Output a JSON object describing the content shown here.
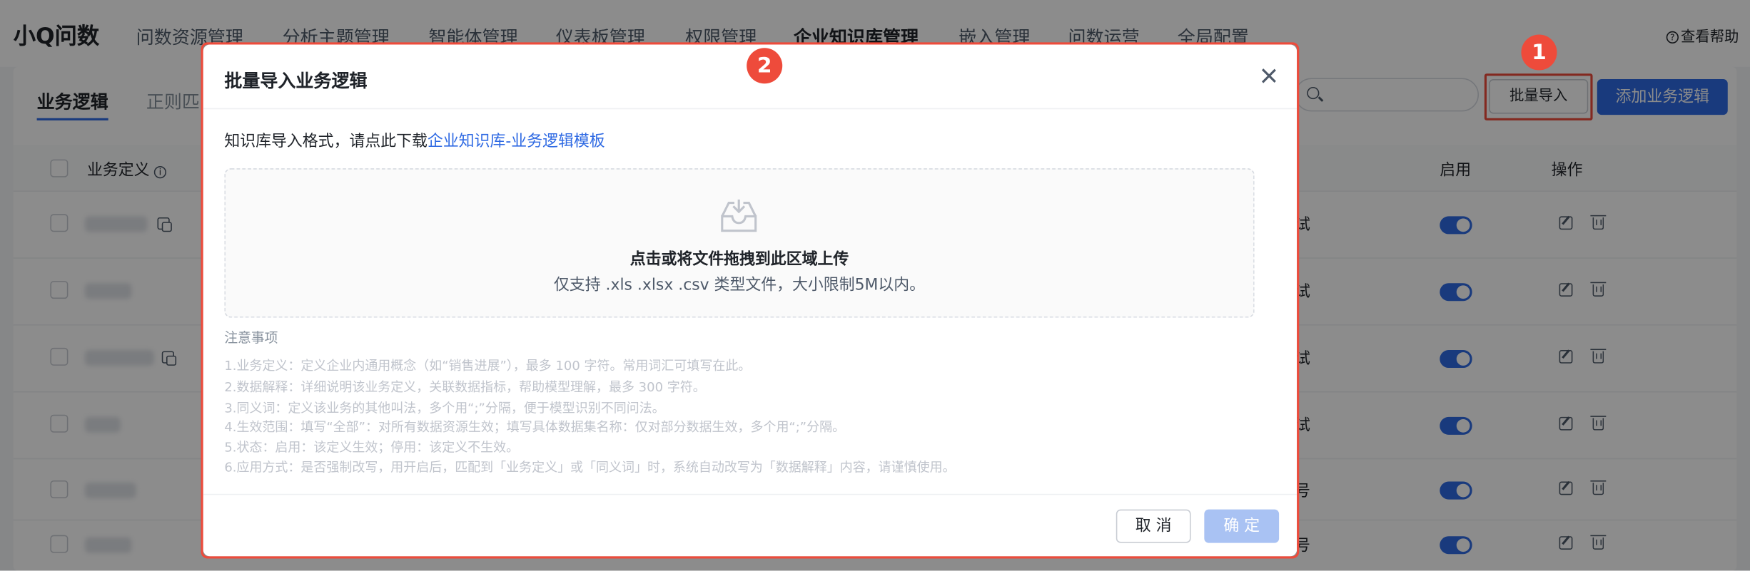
{
  "nav": {
    "brand": "小Q问数",
    "items": [
      "问数资源管理",
      "分析主题管理",
      "智能体管理",
      "仪表板管理",
      "权限管理",
      "企业知识库管理",
      "嵌入管理",
      "问数运营",
      "全局配置"
    ],
    "help": "查看帮助"
  },
  "tabs": {
    "business_logic": "业务逻辑",
    "regex_partial": "正则匹"
  },
  "toolbar": {
    "batch_import": "批量导入",
    "add_logic": "添加业务逻辑"
  },
  "table": {
    "headers": {
      "definition": "业务定义",
      "enabled": "启用",
      "actions": "操作"
    },
    "rows": [
      {
        "cell": "试",
        "enabled": true
      },
      {
        "cell": "试",
        "enabled": true
      },
      {
        "cell": "试",
        "enabled": true
      },
      {
        "cell": "试",
        "enabled": true
      },
      {
        "cell": "号",
        "enabled": true
      },
      {
        "cell": "号",
        "enabled": true
      }
    ]
  },
  "annotations": {
    "step1": "1",
    "step2": "2"
  },
  "modal": {
    "title": "批量导入业务逻辑",
    "format_prefix": "知识库导入格式，请点此下载",
    "template_link": "企业知识库-业务逻辑模板",
    "upload_title": "点击或将文件拖拽到此区域上传",
    "upload_hint": "仅支持 .xls .xlsx .csv 类型文件，大小限制5M以内。",
    "notes_title": "注意事项",
    "notes": [
      "1.业务定义：定义企业内通用概念（如“销售进展”），最多 100 字符。常用词汇可填写在此。",
      "2.数据解释：详细说明该业务定义，关联数据指标，帮助模型理解，最多 300 字符。",
      "3.同义词：定义该业务的其他叫法，多个用“;”分隔，便于模型识别不同问法。",
      "4.生效范围：填写“全部”：对所有数据资源生效；填写具体数据集名称：仅对部分数据生效，多个用“;”分隔。",
      "5.状态：启用：该定义生效；停用：该定义不生效。",
      "6.应用方式：是否强制改写，用开启后，匹配到「业务定义」或「同义词」时，系统自动改写为「数据解释」内容，请谨慎使用。"
    ],
    "cancel": "取 消",
    "confirm": "确 定"
  },
  "colors": {
    "primary": "#2f6ae3",
    "annotation": "#ee4b3b"
  }
}
